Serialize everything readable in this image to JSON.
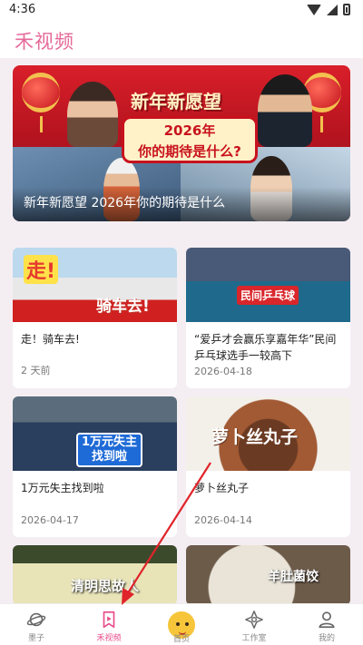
{
  "status": {
    "time": "4:36"
  },
  "header": {
    "title": "禾视频"
  },
  "banner": {
    "headline": "新年新愿望",
    "sub_line1": "2026年",
    "sub_line2": "你的期待是什么?",
    "caption": "新年新愿望 2026年你的期待是什么"
  },
  "cards": [
    {
      "title": "走！骑车去!",
      "date": "2 天前",
      "thumb_text": "骑车去!",
      "thumb_tag": "走!"
    },
    {
      "title": "“爱乒才会赢乐享嘉年华”民间乒乓球选手一较高下",
      "date": "2026-04-18",
      "thumb_text": "民间乒乓球"
    },
    {
      "title": "1万元失主找到啦",
      "date": "2026-04-17",
      "thumb_text": "1万元失主\n找到啦"
    },
    {
      "title": "萝卜丝丸子",
      "date": "2026-04-14",
      "thumb_text": "萝卜丝丸子"
    },
    {
      "title": "",
      "date": "",
      "thumb_text": "清明思故人"
    },
    {
      "title": "",
      "date": "",
      "thumb_text": "羊肚菌饺"
    }
  ],
  "nav": {
    "items": [
      {
        "label": "墨子",
        "icon": "planet-icon"
      },
      {
        "label": "禾视频",
        "icon": "video-bookmark-icon",
        "active": true
      },
      {
        "label": "首页",
        "icon": "mascot-icon"
      },
      {
        "label": "工作室",
        "icon": "studio-icon"
      },
      {
        "label": "我的",
        "icon": "person-icon"
      }
    ]
  },
  "colors": {
    "accent": "#e84c8b",
    "title": "#e56a9a",
    "banner_red": "#d91f2a",
    "annotation_arrow": "#e0242a"
  }
}
